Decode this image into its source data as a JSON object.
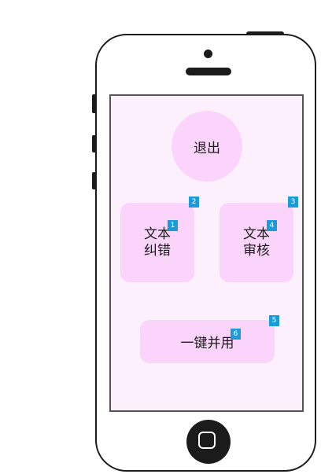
{
  "screen": {
    "exit_label": "退出",
    "text_correction": {
      "line1": "文本",
      "line2": "纠错"
    },
    "text_review": {
      "line1": "文本",
      "line2": "审核"
    },
    "combined_label": "一键并用"
  },
  "badges": [
    "1",
    "2",
    "3",
    "4",
    "5",
    "6"
  ],
  "colors": {
    "screen_bg": "#fdf0fd",
    "button_bg": "#fbd4fb",
    "badge_bg": "#1a9cdb",
    "frame": "#1b1b1b"
  }
}
